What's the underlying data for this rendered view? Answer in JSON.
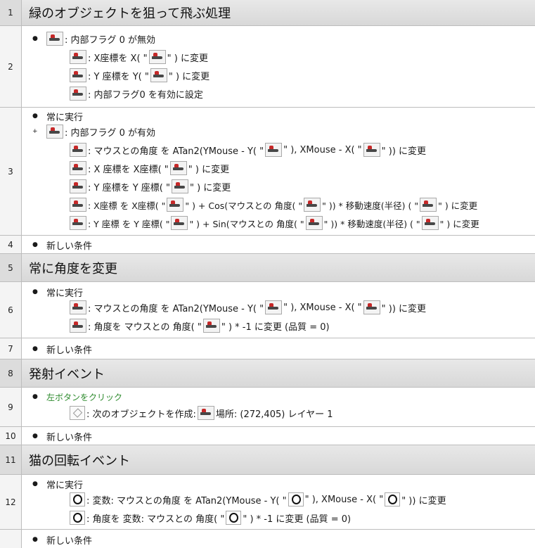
{
  "groups": {
    "g1": {
      "num": "1",
      "title": "緑のオブジェクトを狙って飛ぶ処理"
    },
    "g5": {
      "num": "5",
      "title": "常に角度を変更"
    },
    "g8": {
      "num": "8",
      "title": "発射イベント"
    },
    "g11": {
      "num": "11",
      "title": "猫の回転イベント"
    }
  },
  "events": {
    "e2": {
      "num": "2",
      "cond1": ": 内部フラグ 0 が無効",
      "a1a": ": X座標を X( \"",
      "a1b": "\" ) に変更",
      "a2a": ": Y 座標を Y( \"",
      "a2b": "\" ) に変更",
      "a3": ": 内部フラグ0 を有効に設定"
    },
    "e3": {
      "num": "3",
      "cond1": "常に実行",
      "cond2": ": 内部フラグ 0 が有効",
      "a1a": ": マウスとの角度 を ATan2(YMouse - Y( \"",
      "a1b": "\" ), XMouse - X( \"",
      "a1c": "\" )) に変更",
      "a2a": ": X 座標を X座標( \"",
      "a2b": "\" ) に変更",
      "a3a": ": Y 座標を Y 座標( \"",
      "a3b": "\" ) に変更",
      "a4a": ": X座標 を X座標( \"",
      "a4b": "\" ) + Cos(マウスとの 角度( \"",
      "a4c": "\" )) * 移動速度(半径) ( \"",
      "a4d": "\" ) に変更",
      "a5a": ": Y 座標 を Y 座標( \"",
      "a5b": "\" ) + Sin(マウスとの 角度( \"",
      "a5c": "\" )) * 移動速度(半径) ( \"",
      "a5d": "\" ) に変更"
    },
    "e4": {
      "num": "4",
      "cond1": "新しい条件"
    },
    "e6": {
      "num": "6",
      "cond1": "常に実行",
      "a1a": ": マウスとの角度 を ATan2(YMouse - Y( \"",
      "a1b": "\" ), XMouse - X( \"",
      "a1c": "\" )) に変更",
      "a2a": ": 角度を マウスとの 角度( \"",
      "a2b": "\" ) * -1 に変更 (品質 = 0)"
    },
    "e7": {
      "num": "7",
      "cond1": "新しい条件"
    },
    "e9": {
      "num": "9",
      "cond1": "左ボタンをクリック",
      "a1a": ": 次のオブジェクトを作成:",
      "a1b": "場所: (272,405) レイヤー 1"
    },
    "e10": {
      "num": "10",
      "cond1": "新しい条件"
    },
    "e12": {
      "num": "12",
      "cond1": "常に実行",
      "a1a": ": 変数: マウスとの角度 を ATan2(YMouse - Y( \"",
      "a1b": "\" ), XMouse - X( \"",
      "a1c": "\" )) に変更",
      "a2a": ": 角度を 変数: マウスとの 角度( \"",
      "a2b": "\" ) * -1 に変更 (品質 = 0)"
    },
    "e13": {
      "cond1": "新しい条件"
    }
  },
  "icons": {
    "bullet": "bullet-object-icon",
    "cat": "cat-object-icon",
    "system": "system-object-icon"
  },
  "colors": {
    "group_header": "#dcdcdc",
    "condition_green": "#2e8b2e",
    "bullet_red": "#c62828"
  }
}
